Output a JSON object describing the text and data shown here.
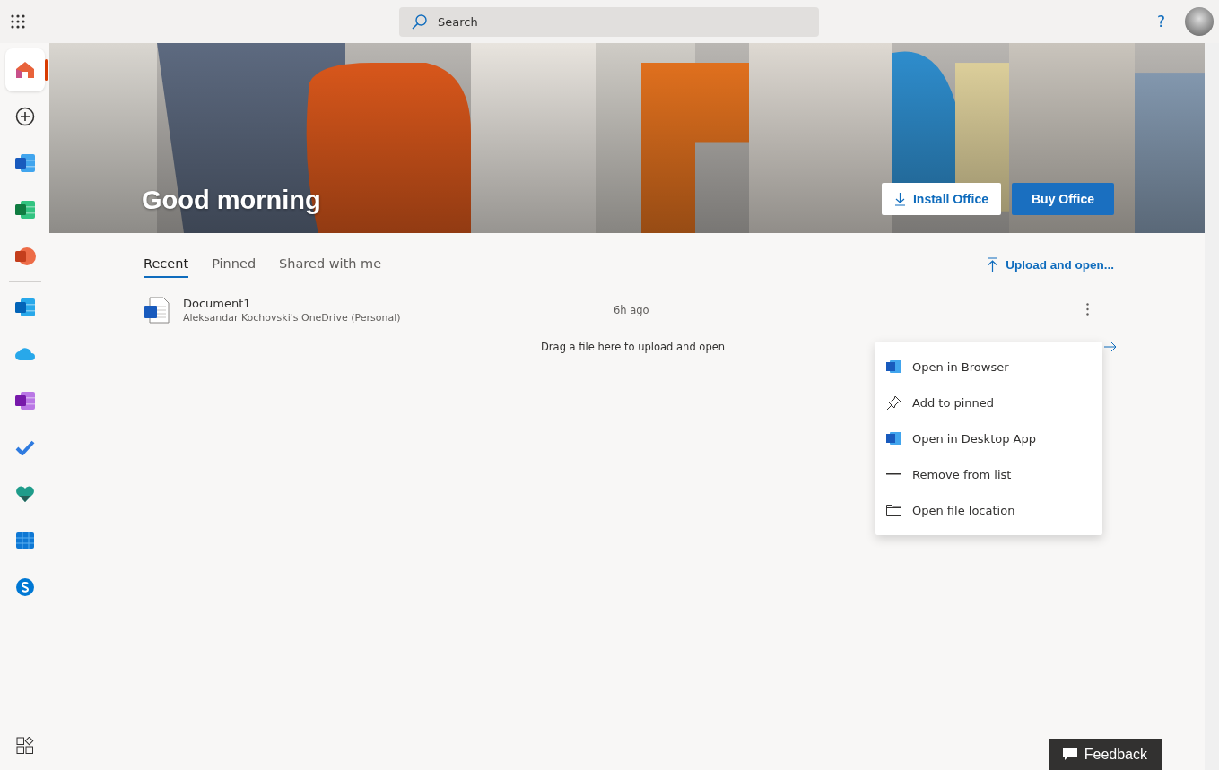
{
  "top_bar": {
    "search": {
      "placeholder": "Search"
    },
    "help": "?"
  },
  "sidebar": {
    "items": [
      {
        "kind": "home",
        "selected": true
      },
      {
        "kind": "create",
        "selected": false
      },
      {
        "kind": "word",
        "selected": false
      },
      {
        "kind": "excel",
        "selected": false
      },
      {
        "kind": "powerpoint",
        "selected": false
      }
    ],
    "more_items": [
      {
        "kind": "outlook",
        "selected": false
      },
      {
        "kind": "onedrive",
        "selected": false
      },
      {
        "kind": "onenote",
        "selected": false
      },
      {
        "kind": "todo",
        "selected": false
      },
      {
        "kind": "family",
        "selected": false
      },
      {
        "kind": "calendar",
        "selected": false
      },
      {
        "kind": "skype",
        "selected": false
      }
    ]
  },
  "hero": {
    "greeting": "Good morning",
    "install_button": "Install Office",
    "buy_button": "Buy Office"
  },
  "tabs": [
    {
      "label": "Recent",
      "selected": true
    },
    {
      "label": "Pinned",
      "selected": false
    },
    {
      "label": "Shared with me",
      "selected": false
    }
  ],
  "upload_link": "Upload and open...",
  "files": [
    {
      "name": "Document1",
      "location": "Aleksandar Kochovski's OneDrive (Personal)",
      "modified": "6h ago"
    }
  ],
  "drop_hint": "Drag a file here to upload and open",
  "context_menu": [
    {
      "kind": "word",
      "label": "Open in Browser"
    },
    {
      "kind": "pin",
      "label": "Add to pinned"
    },
    {
      "kind": "word",
      "label": "Open in Desktop App"
    },
    {
      "kind": "minus",
      "label": "Remove from list"
    },
    {
      "kind": "folder",
      "label": "Open file location"
    }
  ],
  "feedback_button": "Feedback"
}
